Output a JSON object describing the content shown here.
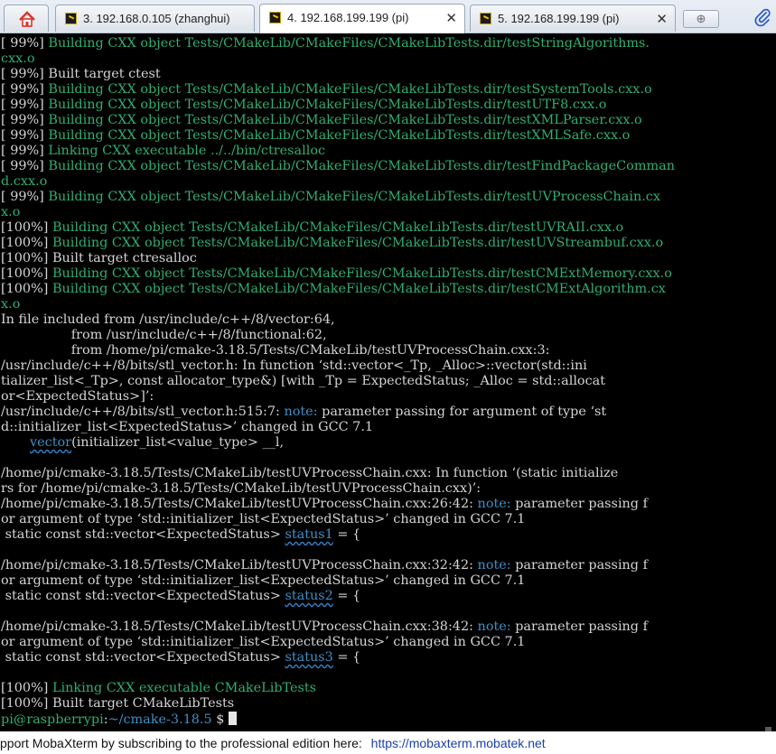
{
  "tabs": [
    {
      "label": "3. 192.168.0.105 (zhanghui)",
      "active": false
    },
    {
      "label": "4. 192.168.199.199 (pi)",
      "active": true
    },
    {
      "label": "5. 192.168.199.199 (pi)",
      "active": false
    }
  ],
  "colors": {
    "green": "#2fae72",
    "white": "#d4d4d4",
    "cyan": "#3e8fc4"
  },
  "icons": [
    "home-icon",
    "terminal-tab-icon",
    "close-icon",
    "new-tab-icon",
    "paperclip-icon"
  ],
  "terminal": {
    "lines": [
      [
        {
          "t": "[ 99%] ",
          "c": "w"
        },
        {
          "t": "Building CXX object Tests/CMakeLib/CMakeFiles/CMakeLibTests.dir/testStringAlgorithms.",
          "c": "g"
        }
      ],
      [
        {
          "t": "cxx.o",
          "c": "g"
        }
      ],
      [
        {
          "t": "[ 99%] Built target ctest",
          "c": "w"
        }
      ],
      [
        {
          "t": "[ 99%] ",
          "c": "w"
        },
        {
          "t": "Building CXX object Tests/CMakeLib/CMakeFiles/CMakeLibTests.dir/testSystemTools.cxx.o",
          "c": "g"
        }
      ],
      [
        {
          "t": "[ 99%] ",
          "c": "w"
        },
        {
          "t": "Building CXX object Tests/CMakeLib/CMakeFiles/CMakeLibTests.dir/testUTF8.cxx.o",
          "c": "g"
        }
      ],
      [
        {
          "t": "[ 99%] ",
          "c": "w"
        },
        {
          "t": "Building CXX object Tests/CMakeLib/CMakeFiles/CMakeLibTests.dir/testXMLParser.cxx.o",
          "c": "g"
        }
      ],
      [
        {
          "t": "[ 99%] ",
          "c": "w"
        },
        {
          "t": "Building CXX object Tests/CMakeLib/CMakeFiles/CMakeLibTests.dir/testXMLSafe.cxx.o",
          "c": "g"
        }
      ],
      [
        {
          "t": "[ 99%] ",
          "c": "w"
        },
        {
          "t": "Linking CXX executable ../../bin/ctresalloc",
          "c": "g"
        }
      ],
      [
        {
          "t": "[ 99%] ",
          "c": "w"
        },
        {
          "t": "Building CXX object Tests/CMakeLib/CMakeFiles/CMakeLibTests.dir/testFindPackageComman",
          "c": "g"
        }
      ],
      [
        {
          "t": "d.cxx.o",
          "c": "g"
        }
      ],
      [
        {
          "t": "[ 99%] ",
          "c": "w"
        },
        {
          "t": "Building CXX object Tests/CMakeLib/CMakeFiles/CMakeLibTests.dir/testUVProcessChain.cx",
          "c": "g"
        }
      ],
      [
        {
          "t": "x.o",
          "c": "g"
        }
      ],
      [
        {
          "t": "[100%] ",
          "c": "w"
        },
        {
          "t": "Building CXX object Tests/CMakeLib/CMakeFiles/CMakeLibTests.dir/testUVRAII.cxx.o",
          "c": "g"
        }
      ],
      [
        {
          "t": "[100%] ",
          "c": "w"
        },
        {
          "t": "Building CXX object Tests/CMakeLib/CMakeFiles/CMakeLibTests.dir/testUVStreambuf.cxx.o",
          "c": "g"
        }
      ],
      [
        {
          "t": "[100%] Built target ctresalloc",
          "c": "w"
        }
      ],
      [
        {
          "t": "[100%] ",
          "c": "w"
        },
        {
          "t": "Building CXX object Tests/CMakeLib/CMakeFiles/CMakeLibTests.dir/testCMExtMemory.cxx.o",
          "c": "g"
        }
      ],
      [
        {
          "t": "[100%] ",
          "c": "w"
        },
        {
          "t": "Building CXX object Tests/CMakeLib/CMakeFiles/CMakeLibTests.dir/testCMExtAlgorithm.cx",
          "c": "g"
        }
      ],
      [
        {
          "t": "x.o",
          "c": "g"
        }
      ],
      [
        {
          "t": "In file included from /usr/include/c++/8/vector:64,",
          "c": "w"
        }
      ],
      [
        {
          "t": "                 from /usr/include/c++/8/functional:62,",
          "c": "w"
        }
      ],
      [
        {
          "t": "                 from /home/pi/cmake-3.18.5/Tests/CMakeLib/testUVProcessChain.cxx:3:",
          "c": "w"
        }
      ],
      [
        {
          "t": "/usr/include/c++/8/bits/stl_vector.h: In function ‘std::vector<_Tp, _Alloc>::vector(std::ini",
          "c": "w"
        }
      ],
      [
        {
          "t": "tializer_list<_Tp>, const allocator_type&) [with _Tp = ExpectedStatus; _Alloc = std::allocat",
          "c": "w"
        }
      ],
      [
        {
          "t": "or<ExpectedStatus>]’:",
          "c": "w"
        }
      ],
      [
        {
          "t": "/usr/include/c++/8/bits/stl_vector.h:515:7: ",
          "c": "w"
        },
        {
          "t": "note:",
          "c": "n"
        },
        {
          "t": " parameter passing for argument of type ‘st",
          "c": "w"
        }
      ],
      [
        {
          "t": "d::initializer_list<ExpectedStatus>’ changed in GCC 7.1",
          "c": "w"
        }
      ],
      [
        {
          "t": "       ",
          "c": "w"
        },
        {
          "t": "vector",
          "c": "c",
          "sq": true
        },
        {
          "t": "(initializer_list<value_type> __l,",
          "c": "w"
        }
      ],
      [
        {
          "t": "",
          "c": "w"
        }
      ],
      [
        {
          "t": "/home/pi/cmake-3.18.5/Tests/CMakeLib/testUVProcessChain.cxx: In function ‘(static initialize",
          "c": "w"
        }
      ],
      [
        {
          "t": "rs for /home/pi/cmake-3.18.5/Tests/CMakeLib/testUVProcessChain.cxx)’:",
          "c": "w"
        }
      ],
      [
        {
          "t": "/home/pi/cmake-3.18.5/Tests/CMakeLib/testUVProcessChain.cxx:26:42: ",
          "c": "w"
        },
        {
          "t": "note:",
          "c": "n"
        },
        {
          "t": " parameter passing f",
          "c": "w"
        }
      ],
      [
        {
          "t": "or argument of type ‘std::initializer_list<ExpectedStatus>’ changed in GCC 7.1",
          "c": "w"
        }
      ],
      [
        {
          "t": " static const std::vector<ExpectedStatus> ",
          "c": "w"
        },
        {
          "t": "status1",
          "c": "c",
          "sq": true
        },
        {
          "t": " = {",
          "c": "w"
        }
      ],
      [
        {
          "t": "",
          "c": "w"
        }
      ],
      [
        {
          "t": "/home/pi/cmake-3.18.5/Tests/CMakeLib/testUVProcessChain.cxx:32:42: ",
          "c": "w"
        },
        {
          "t": "note:",
          "c": "n"
        },
        {
          "t": " parameter passing f",
          "c": "w"
        }
      ],
      [
        {
          "t": "or argument of type ‘std::initializer_list<ExpectedStatus>’ changed in GCC 7.1",
          "c": "w"
        }
      ],
      [
        {
          "t": " static const std::vector<ExpectedStatus> ",
          "c": "w"
        },
        {
          "t": "status2",
          "c": "c",
          "sq": true
        },
        {
          "t": " = {",
          "c": "w"
        }
      ],
      [
        {
          "t": "",
          "c": "w"
        }
      ],
      [
        {
          "t": "/home/pi/cmake-3.18.5/Tests/CMakeLib/testUVProcessChain.cxx:38:42: ",
          "c": "w"
        },
        {
          "t": "note:",
          "c": "n"
        },
        {
          "t": " parameter passing f",
          "c": "w"
        }
      ],
      [
        {
          "t": "or argument of type ‘std::initializer_list<ExpectedStatus>’ changed in GCC 7.1",
          "c": "w"
        }
      ],
      [
        {
          "t": " static const std::vector<ExpectedStatus> ",
          "c": "w"
        },
        {
          "t": "status3",
          "c": "c",
          "sq": true
        },
        {
          "t": " = {",
          "c": "w"
        }
      ],
      [
        {
          "t": "",
          "c": "w"
        }
      ],
      [
        {
          "t": "[100%] ",
          "c": "w"
        },
        {
          "t": "Linking CXX executable CMakeLibTests",
          "c": "g"
        }
      ],
      [
        {
          "t": "[100%] Built target CMakeLibTests",
          "c": "w"
        }
      ]
    ],
    "prompt": {
      "user": "pi@raspberrypi",
      "sep": ":",
      "path": "~/cmake-3.18.5",
      "symbol": " $ "
    }
  },
  "status": {
    "message": "pport MobaXterm by subscribing to the professional edition here:",
    "link": "https://mobaxterm.mobatek.net"
  }
}
